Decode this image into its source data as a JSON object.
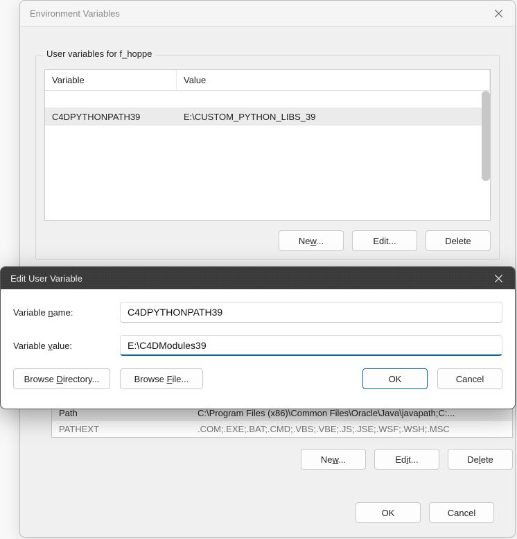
{
  "env_window": {
    "title": "Environment Variables",
    "user_vars_group_title": "User variables for f_hoppe",
    "columns": {
      "variable": "Variable",
      "value": "Value"
    },
    "user_rows": [
      {
        "variable": "C4DPYTHONPATH39",
        "value": "E:\\CUSTOM_PYTHON_LIBS_39",
        "selected": true
      }
    ],
    "buttons": {
      "new": "New...",
      "edit": "Edit...",
      "delete": "Delete"
    },
    "sys_rows": [
      {
        "variable": "Path",
        "value": "C:\\Program Files (x86)\\Common Files\\Oracle\\Java\\javapath;C:...",
        "selected": true
      },
      {
        "variable": "PATHEXT",
        "value": ".COM;.EXE;.BAT;.CMD;.VBS;.VBE;.JS;.JSE;.WSF;.WSH;.MSC",
        "selected": false
      }
    ],
    "sys_buttons": {
      "new": "New...",
      "edit": "Edit...",
      "delete": "Delete"
    },
    "ok": "OK",
    "cancel": "Cancel"
  },
  "edit_modal": {
    "title": "Edit User Variable",
    "name_label": "Variable name:",
    "name_value": "C4DPYTHONPATH39",
    "value_label": "Variable value:",
    "value_value": "E:\\C4DModules39",
    "browse_dir": "Browse Directory...",
    "browse_file": "Browse File...",
    "ok": "OK",
    "cancel": "Cancel"
  }
}
